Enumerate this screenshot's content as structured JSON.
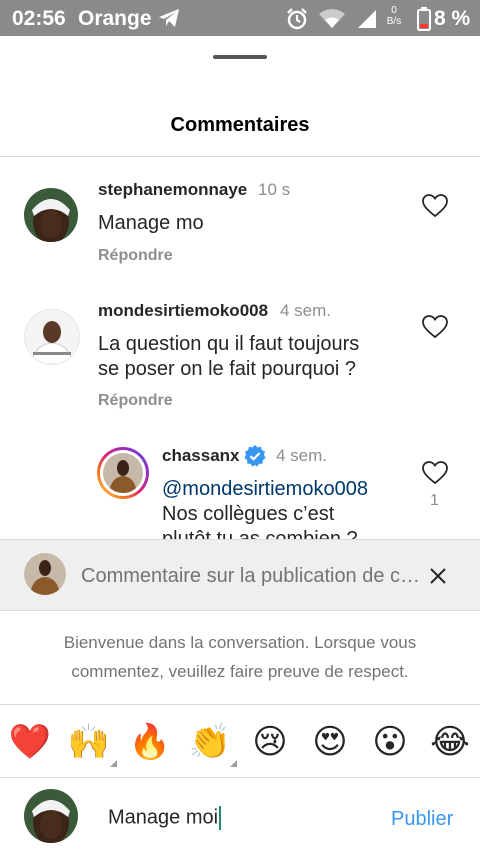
{
  "status_bar": {
    "time": "02:56",
    "carrier": "Orange",
    "net_speed_value": "0",
    "net_speed_unit": "B/s",
    "battery": "8 %"
  },
  "sheet": {
    "title": "Commentaires"
  },
  "comments": [
    {
      "username": "stephanemonnaye",
      "time": "10 s",
      "text": "Manage mo",
      "reply_label": "Répondre"
    },
    {
      "username": "mondesirtiemoko008",
      "time": "4 sem.",
      "text_line1": "La question qu il faut toujours",
      "text_line2": "se poser on le fait pourquoi ?",
      "reply_label": "Répondre"
    },
    {
      "username": "chassanx",
      "verified": true,
      "time": "4 sem.",
      "mention": "@mondesirtiemoko008",
      "text_line1": "Nos collègues c’est",
      "text_line2": "plutôt tu as combien ?",
      "likes": "1"
    }
  ],
  "reply_bar": {
    "placeholder": "Commentaire sur la publication de chassanx…"
  },
  "welcome_text": "Bienvenue dans la conversation. Lorsque vous commentez, veuillez faire preuve de respect.",
  "emojis": [
    "❤️",
    "🙌",
    "🔥",
    "👏",
    "😢",
    "😍",
    "😮",
    "😂"
  ],
  "composer": {
    "input_value": "Manage moi",
    "publish_label": "Publier"
  },
  "colors": {
    "status_bar": "#8a8a8a",
    "link_blue": "#3897f0",
    "mention_blue": "#00376b",
    "verified_blue": "#3897f0"
  }
}
